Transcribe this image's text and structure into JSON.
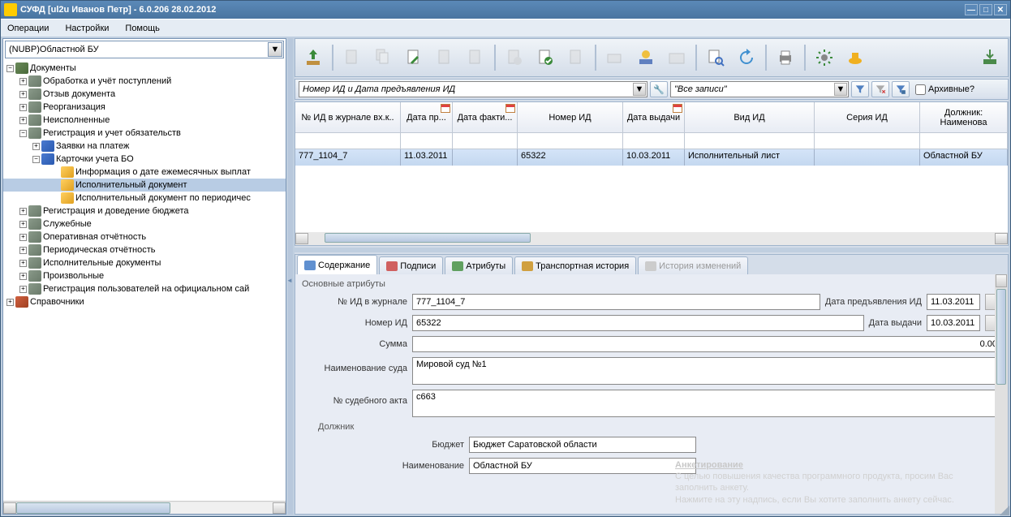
{
  "window": {
    "title": "СУФД [ul2u Иванов Петр] - 6.0.206 28.02.2012"
  },
  "menu": {
    "operations": "Операции",
    "settings": "Настройки",
    "help": "Помощь"
  },
  "left": {
    "combo": "(NUBP)Областной БУ",
    "tree": {
      "documents": "Документы",
      "processing": "Обработка и учёт поступлений",
      "recall": "Отзыв документа",
      "reorg": "Реорганизация",
      "unexecuted": "Неисполненные",
      "registration": "Регистрация и учет обязательств",
      "payreq": "Заявки на платеж",
      "bocards": "Карточки учета БО",
      "monthly": "Информация о дате ежемесячных выплат",
      "execdoc": "Исполнительный документ",
      "execdoc_periodic": "Исполнительный документ по периодичес",
      "budget_reg": "Регистрация и доведение бюджета",
      "service": "Служебные",
      "op_reporting": "Оперативная отчётность",
      "period_reporting": "Периодическая отчётность",
      "exec_docs": "Исполнительные документы",
      "arbitrary": "Произвольные",
      "user_reg": "Регистрация пользователей на официальном сай",
      "reference": "Справочники"
    }
  },
  "filter": {
    "preset": "Номер ИД и Дата предъявления ИД",
    "records": "Все записи",
    "archive": "Архивные?"
  },
  "grid": {
    "headers": {
      "journal_no": "№ ИД в журнале вх.к..",
      "date_pr": "Дата пр...",
      "date_fact": "Дата факти...",
      "id_no": "Номер ИД",
      "date_issue": "Дата выдачи",
      "id_type": "Вид ИД",
      "id_series": "Серия ИД",
      "debtor": "Должник: Наименова"
    },
    "row": {
      "journal_no": "777_1104_7",
      "date_pr": "11.03.2011",
      "date_fact": "",
      "id_no": "65322",
      "date_issue": "10.03.2011",
      "id_type": "Исполнительный лист",
      "id_series": "",
      "debtor": "Областной БУ"
    }
  },
  "tabs": {
    "content": "Содержание",
    "signatures": "Подписи",
    "attributes": "Атрибуты",
    "transport": "Транспортная история",
    "history": "История изменений"
  },
  "form": {
    "main_attrs": "Основные атрибуты",
    "lbl_journal": "№ ИД в журнале",
    "val_journal": "777_1104_7",
    "lbl_date_pres": "Дата предъявления ИД",
    "val_date_pres": "11.03.2011",
    "lbl_id_no": "Номер ИД",
    "val_id_no": "65322",
    "lbl_date_issue": "Дата выдачи",
    "val_date_issue": "10.03.2011",
    "lbl_sum": "Сумма",
    "val_sum": "0.00",
    "lbl_court": "Наименование суда",
    "val_court": "Мировой суд №1",
    "lbl_act_no": "№ судебного акта",
    "val_act_no": "с663",
    "debtor_section": "Должник",
    "lbl_budget": "Бюджет",
    "val_budget": "Бюджет Саратовской области",
    "lbl_name": "Наименование",
    "val_name": "Областной БУ"
  },
  "watermark": {
    "title": "Анкетирование",
    "line1": "С целью повышения качества программного продукта, просим Вас заполнить анкету.",
    "line2": "Нажмите на эту надпись, если Вы хотите заполнить анкету сейчас."
  },
  "cols": {
    "c1": 130,
    "c2": 64,
    "c3": 80,
    "c4": 130,
    "c5": 76,
    "c6": 160,
    "c7": 130,
    "c8": 110
  }
}
